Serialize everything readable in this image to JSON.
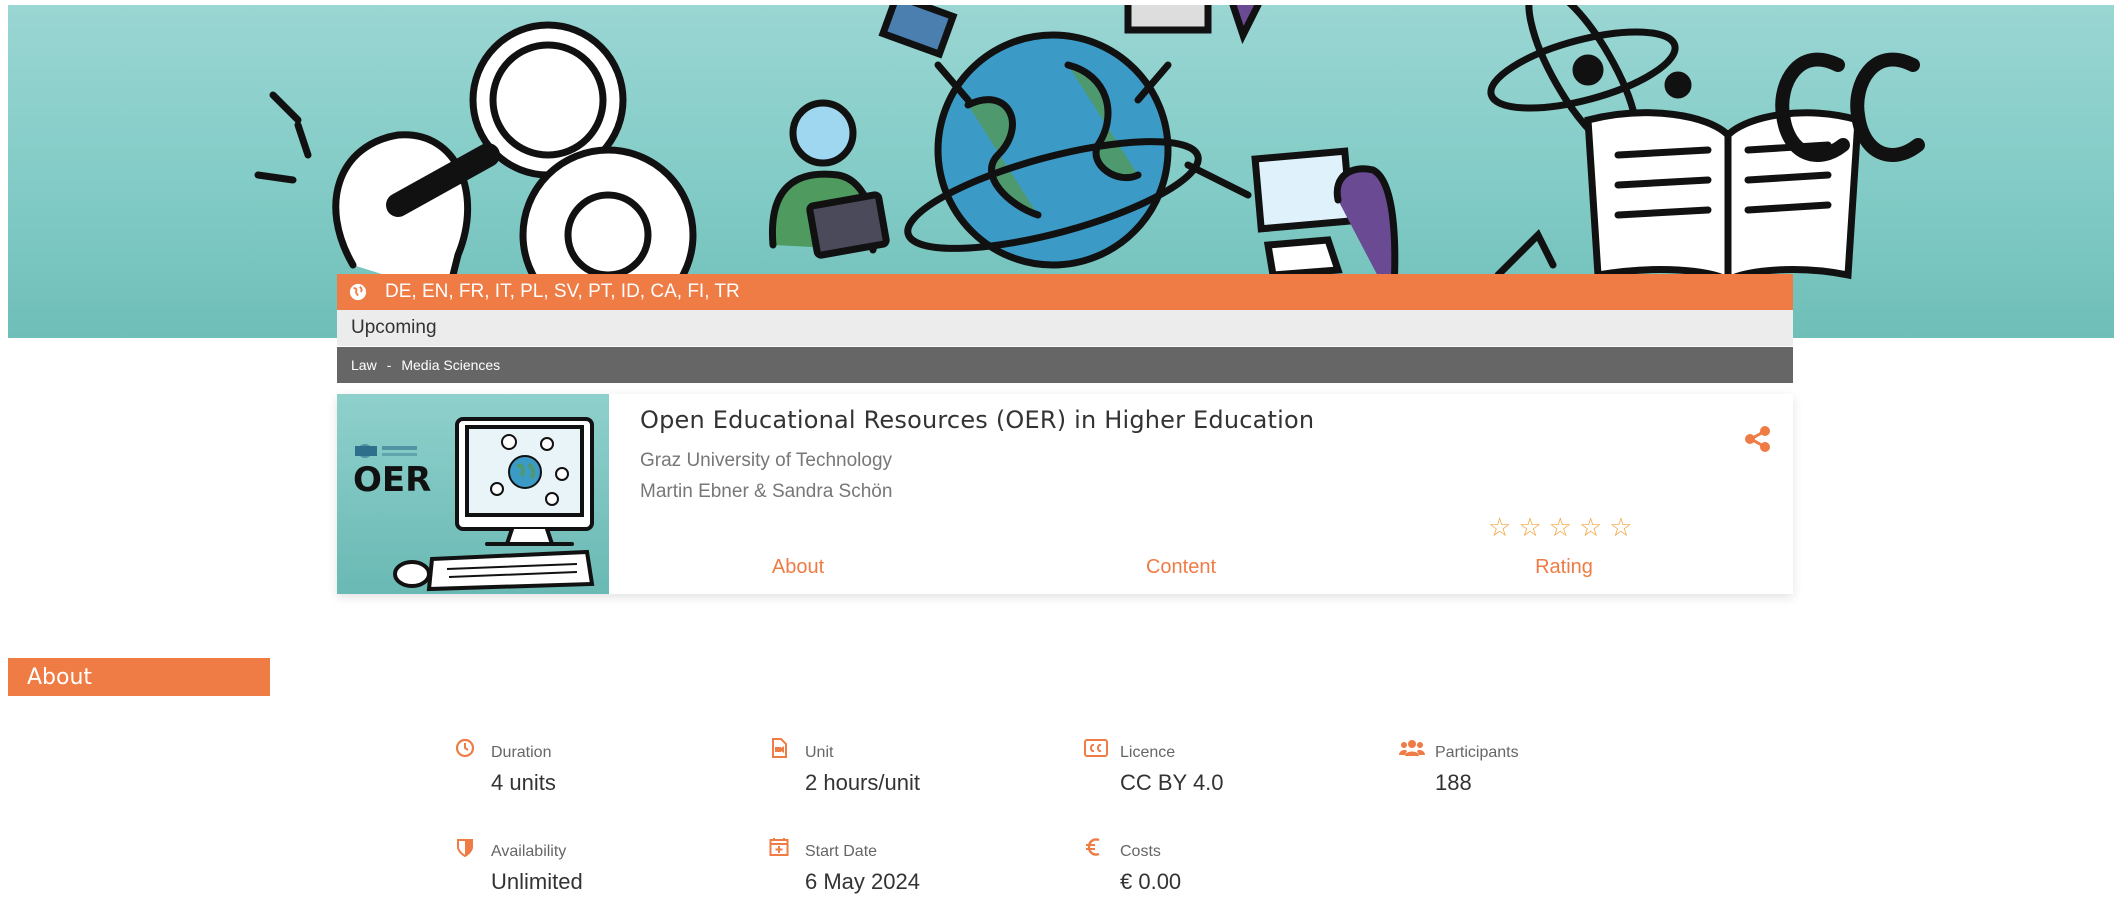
{
  "header": {
    "languages": "DE, EN, FR, IT, PL, SV, PT, ID, CA, FI, TR",
    "status": "Upcoming",
    "categories": [
      "Law",
      "Media Sciences"
    ],
    "category_separator": "-"
  },
  "course": {
    "title": "Open Educational Resources (OER) in Higher Education",
    "university": "Graz University of Technology",
    "authors": "Martin Ebner & Sandra Schön",
    "thumbnail_text": "OER",
    "rating_stars": 0,
    "rating_max": 5,
    "tabs": [
      "About",
      "Content",
      "Rating"
    ]
  },
  "about": {
    "heading": "About",
    "facts": [
      {
        "label": "Duration",
        "value": "4 units",
        "icon": "clock-icon"
      },
      {
        "label": "Unit",
        "value": "2 hours/unit",
        "icon": "video-file-icon"
      },
      {
        "label": "Licence",
        "value": "CC BY 4.0",
        "icon": "cc-icon"
      },
      {
        "label": "Participants",
        "value": "188",
        "icon": "users-icon"
      },
      {
        "label": "Availability",
        "value": "Unlimited",
        "icon": "shield-icon"
      },
      {
        "label": "Start Date",
        "value": "6 May 2024",
        "icon": "calendar-plus-icon"
      },
      {
        "label": "Costs",
        "value": "€ 0.00",
        "icon": "euro-icon"
      }
    ]
  },
  "colors": {
    "accent": "#ef7b45",
    "banner": "#8fd0cc",
    "category_bar": "#666666",
    "status_bar": "#ececec"
  }
}
